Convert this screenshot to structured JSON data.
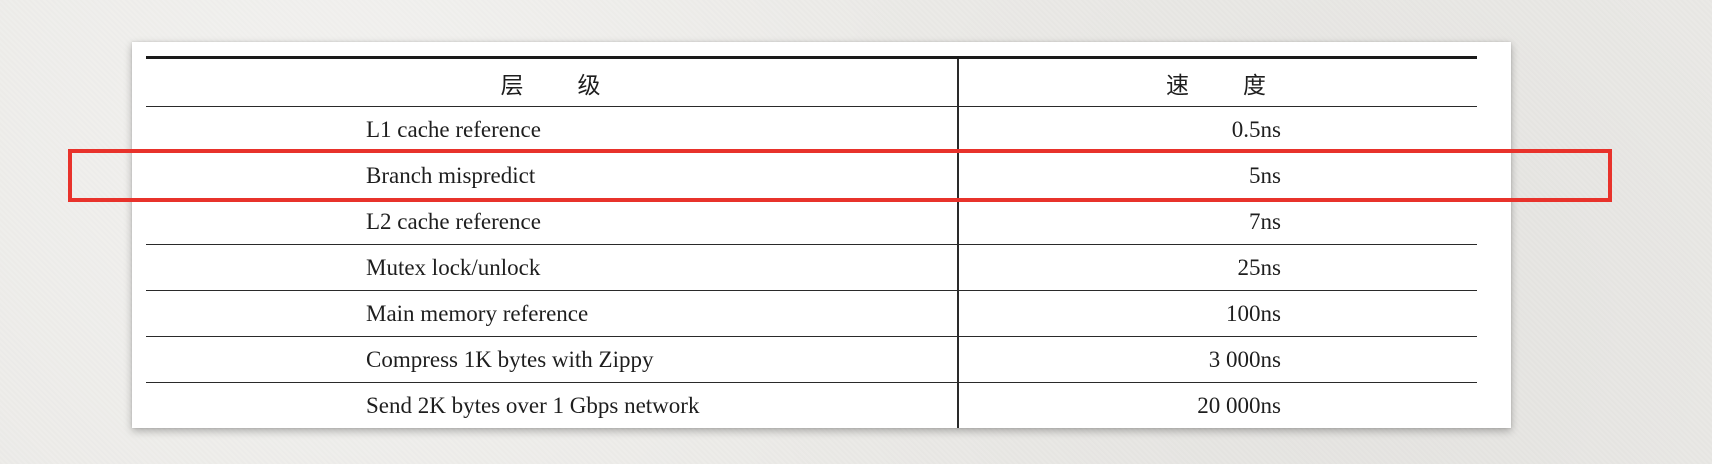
{
  "table": {
    "header": {
      "level_char1": "层",
      "level_char2": "级",
      "speed_char1": "速",
      "speed_char2": "度"
    },
    "rows": [
      {
        "name": "L1 cache reference",
        "speed": "0.5ns"
      },
      {
        "name": "Branch mispredict",
        "speed": "5ns"
      },
      {
        "name": "L2 cache reference",
        "speed": "7ns"
      },
      {
        "name": "Mutex lock/unlock",
        "speed": "25ns"
      },
      {
        "name": "Main memory reference",
        "speed": "100ns"
      },
      {
        "name": "Compress 1K bytes with Zippy",
        "speed": "3 000ns"
      },
      {
        "name": "Send 2K bytes over 1 Gbps network",
        "speed": "20 000ns"
      }
    ]
  },
  "highlight": {
    "target": "Branch mispredict",
    "color": "#e8322b"
  },
  "colors": {
    "background": "#ecebe8",
    "paper": "#ffffff",
    "text": "#1e1e1e",
    "rule": "#2a2a2a"
  }
}
